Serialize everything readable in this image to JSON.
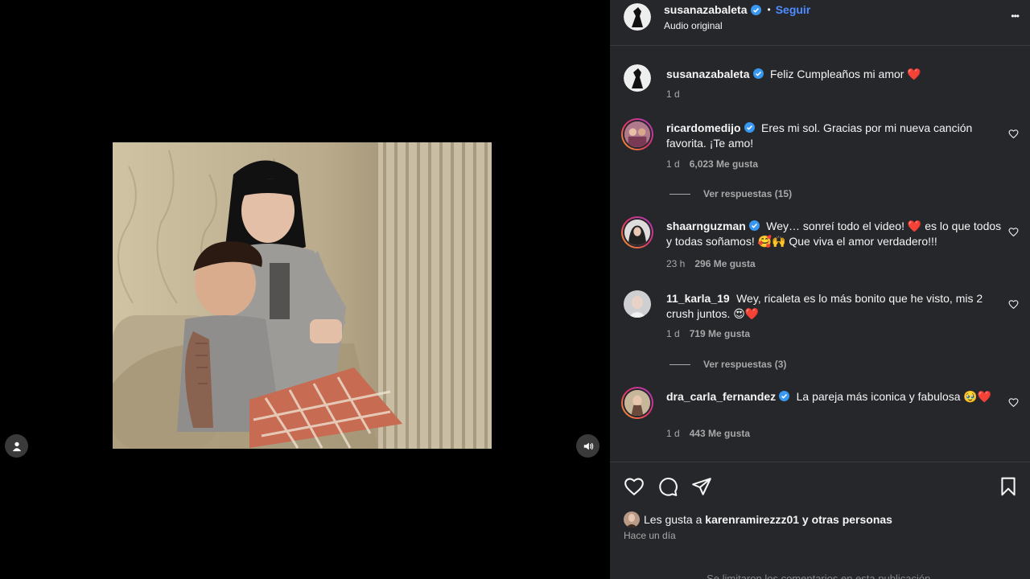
{
  "post": {
    "author": "susanazabaleta",
    "follow_label": "Seguir",
    "dot": "•",
    "audio": "Audio original",
    "more": "•••"
  },
  "caption": {
    "username": "susanazabaleta",
    "text": "Feliz Cumpleaños mi amor ❤️",
    "time": "1 d"
  },
  "comments": [
    {
      "username": "ricardomedijo",
      "verified": true,
      "text": "Eres mi sol. Gracias por mi nueva canción favorita. ¡Te amo!",
      "time": "1 d",
      "likes": "6,023 Me gusta",
      "replies": "Ver respuestas (15)"
    },
    {
      "username": "shaarnguzman",
      "verified": true,
      "text": "Wey… sonreí todo el video! ❤️ es lo que todos y todas soñamos! 🥰🙌 Que viva el amor verdadero!!!",
      "time": "23 h",
      "likes": "296 Me gusta"
    },
    {
      "username": "11_karla_19",
      "verified": false,
      "text": "Wey, ricaleta es lo más bonito que he visto, mis 2 crush juntos. 😍❤️",
      "time": "1 d",
      "likes": "719 Me gusta",
      "replies": "Ver respuestas (3)"
    },
    {
      "username": "dra_carla_fernandez",
      "verified": true,
      "text": "La pareja más iconica y fabulosa 🥹❤️",
      "time": "1 d",
      "likes": "443 Me gusta"
    }
  ],
  "footer": {
    "liked_prefix": "Les gusta a ",
    "liked_user": "karenramirezzz01",
    "liked_suffix": " y otras personas",
    "date": "Hace un día",
    "limit_note": "Se limitaron los comentarios en esta publicación."
  },
  "icons": {
    "user": "user-icon",
    "volume": "volume-icon",
    "verified": "verified-badge-icon",
    "heart": "heart-icon",
    "comment": "comment-icon",
    "share": "share-icon",
    "bookmark": "bookmark-icon",
    "more": "more-options-icon"
  },
  "colors": {
    "panel_bg": "#26272b",
    "link": "#4f8cff",
    "verified": "#3897f0",
    "muted": "#a8a8a8"
  }
}
